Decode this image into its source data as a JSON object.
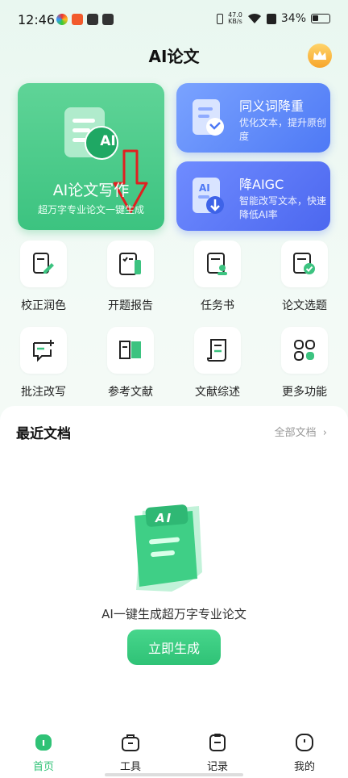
{
  "status_bar": {
    "time": "12:46",
    "net_speed": "47.0",
    "net_unit": "KB/s",
    "battery": "34%"
  },
  "header": {
    "title": "AI论文"
  },
  "hero": {
    "main": {
      "badge": "AI",
      "title": "AI论文写作",
      "subtitle": "超万字专业论文一键生成"
    },
    "cards": [
      {
        "title": "同义词降重",
        "desc": "优化文本，提升原创度"
      },
      {
        "title": "降AIGC",
        "badge": "AI",
        "desc": "智能改写文本，快速降低AI率"
      }
    ]
  },
  "tools": [
    {
      "label": "校正润色",
      "icon": "edit-doc-icon"
    },
    {
      "label": "开题报告",
      "icon": "report-icon"
    },
    {
      "label": "任务书",
      "icon": "task-book-icon"
    },
    {
      "label": "论文选题",
      "icon": "topic-check-icon"
    },
    {
      "label": "批注改写",
      "icon": "comment-add-icon"
    },
    {
      "label": "参考文献",
      "icon": "book-open-icon"
    },
    {
      "label": "文献综述",
      "icon": "scroll-icon"
    },
    {
      "label": "更多功能",
      "icon": "grid-more-icon"
    }
  ],
  "recent": {
    "title": "最近文档",
    "all_label": "全部文档",
    "illus_badge": "AI",
    "empty_text": "AI一键生成超万字专业论文",
    "cta": "立即生成"
  },
  "nav": [
    {
      "label": "首页",
      "active": true
    },
    {
      "label": "工具"
    },
    {
      "label": "记录"
    },
    {
      "label": "我的"
    }
  ],
  "colors": {
    "brand_green": "#2fc276",
    "blue_card": "#4e79f5",
    "annotation_arrow": "#e02020"
  }
}
